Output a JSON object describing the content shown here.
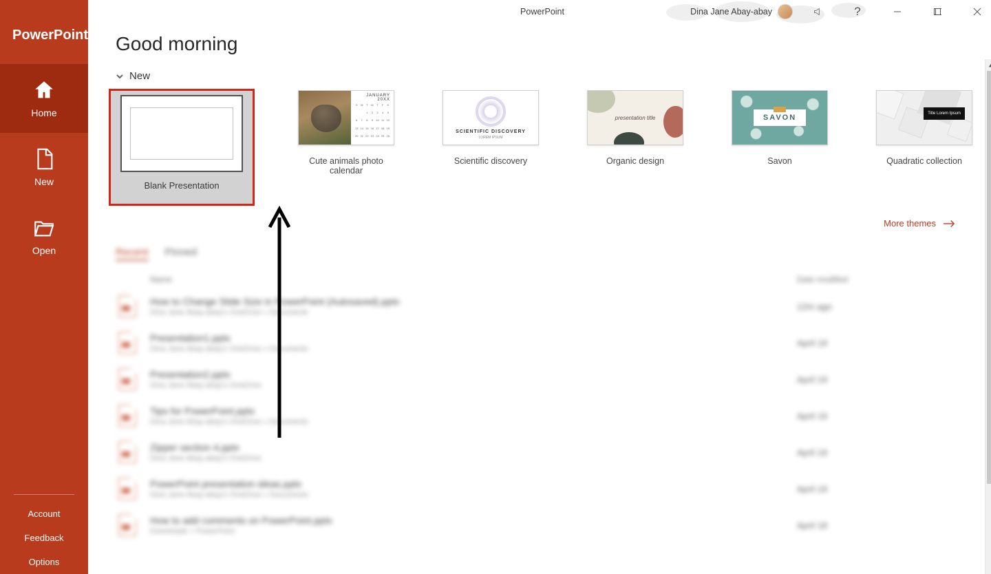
{
  "app_title": "PowerPoint",
  "brand": "PowerPoint",
  "user_name": "Dina Jane Abay-abay",
  "greeting": "Good morning",
  "sidebar": {
    "home": "Home",
    "new": "New",
    "open": "Open",
    "account": "Account",
    "feedback": "Feedback",
    "options": "Options"
  },
  "section_new": "New",
  "more_themes": "More themes",
  "templates": [
    {
      "label": "Blank Presentation"
    },
    {
      "label": "Cute animals photo calendar",
      "month": "JANUARY 20XX"
    },
    {
      "label": "Scientific discovery",
      "thumb_text": "SCIENTIFIC DISCOVERY",
      "thumb_sub": "LOREM IPSUM"
    },
    {
      "label": "Organic design",
      "thumb_text": "presentation title"
    },
    {
      "label": "Savon",
      "thumb_text": "SAVON"
    },
    {
      "label": "Quadratic collection",
      "thumb_text": "Title Lorem Ipsum"
    }
  ],
  "recent": {
    "tab_recent": "Recent",
    "tab_pinned": "Pinned",
    "col_name": "Name",
    "col_date": "Date modified",
    "rows": [
      {
        "title": "How to Change Slide Size in PowerPoint (Autosaved).pptx",
        "path": "Dina Jane Abay-abay's OneDrive » Documents",
        "date": "12m ago"
      },
      {
        "title": "Presentation1.pptx",
        "path": "Dina Jane Abay-abay's OneDrive » Documents",
        "date": "April 19"
      },
      {
        "title": "Presentation2.pptx",
        "path": "Dina Jane Abay-abay's OneDrive",
        "date": "April 19"
      },
      {
        "title": "Tips for PowerPoint.pptx",
        "path": "Dina Jane Abay-abay's OneDrive » Documents",
        "date": "April 19"
      },
      {
        "title": "Zipper section 4.pptx",
        "path": "Dina Jane Abay-abay's OneDrive",
        "date": "April 19"
      },
      {
        "title": "PowerPoint presentation ideas.pptx",
        "path": "Dina Jane Abay-abay's OneDrive » Documents",
        "date": "April 18"
      },
      {
        "title": "How to add comments on PowerPoint.pptx",
        "path": "Downloads » PowerPoint",
        "date": "April 18"
      }
    ]
  }
}
